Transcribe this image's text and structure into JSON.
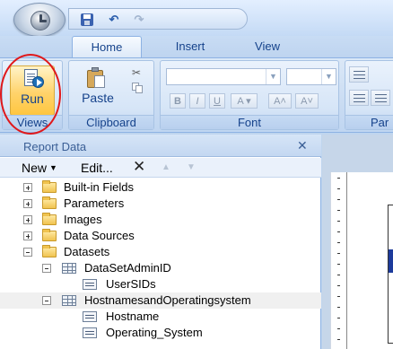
{
  "ribbon": {
    "tabs": {
      "home": "Home",
      "insert": "Insert",
      "view": "View"
    },
    "groups": {
      "views": {
        "label": "Views",
        "run_label": "Run"
      },
      "clipboard": {
        "label": "Clipboard",
        "paste_label": "Paste"
      },
      "font": {
        "label": "Font"
      },
      "paragraph": {
        "label": "Par"
      }
    }
  },
  "report_data": {
    "title": "Report Data",
    "toolbar": {
      "new_label": "New",
      "edit_label": "Edit..."
    },
    "tree": {
      "builtin_fields": "Built-in Fields",
      "parameters": "Parameters",
      "images": "Images",
      "data_sources": "Data Sources",
      "datasets": "Datasets",
      "dataset_admin": "DataSetAdminID",
      "field_usersids": "UserSIDs",
      "dataset_hosts": "HostnamesandOperatingsystem",
      "field_hostname": "Hostname",
      "field_os": "Operating_System"
    }
  },
  "colors": {
    "accent": "#15428b",
    "highlight_circle": "#e0181b",
    "run_button": "#ffc640"
  }
}
